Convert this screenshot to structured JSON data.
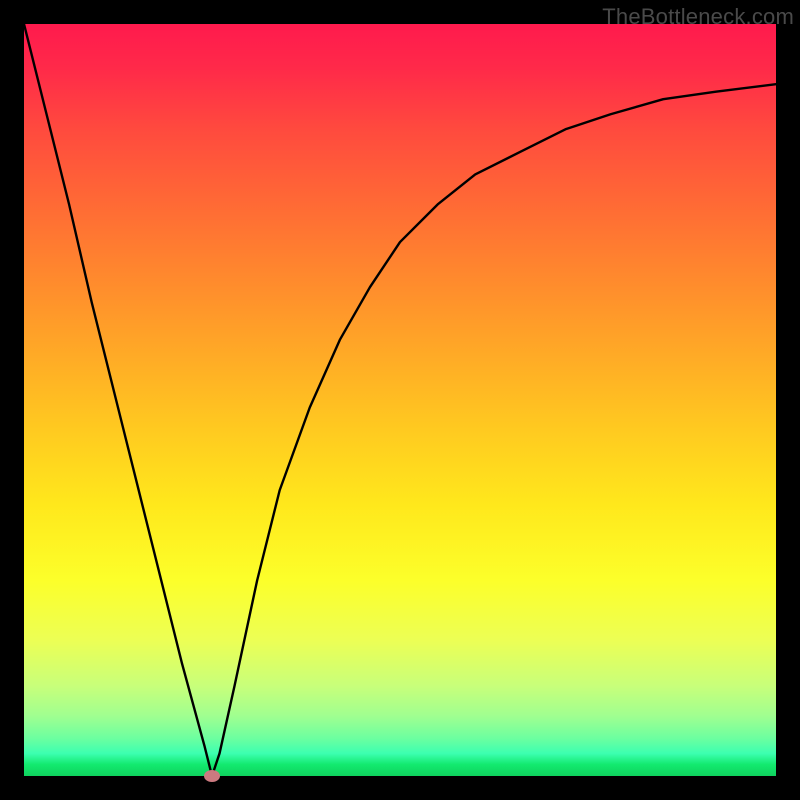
{
  "watermark": "TheBottleneck.com",
  "chart_data": {
    "type": "line",
    "title": "",
    "xlabel": "",
    "ylabel": "",
    "xlim": [
      0,
      100
    ],
    "ylim": [
      0,
      100
    ],
    "grid": false,
    "legend": false,
    "background": "gradient-red-to-green",
    "series": [
      {
        "name": "bottleneck-curve",
        "x": [
          0,
          3,
          6,
          9,
          12,
          15,
          18,
          21,
          24,
          25,
          26,
          28,
          31,
          34,
          38,
          42,
          46,
          50,
          55,
          60,
          66,
          72,
          78,
          85,
          92,
          100
        ],
        "y": [
          100,
          88,
          76,
          63,
          51,
          39,
          27,
          15,
          4,
          0,
          3,
          12,
          26,
          38,
          49,
          58,
          65,
          71,
          76,
          80,
          83,
          86,
          88,
          90,
          91,
          92
        ]
      }
    ],
    "marker": {
      "x": 25,
      "y": 0,
      "color": "#cc7a80"
    }
  }
}
